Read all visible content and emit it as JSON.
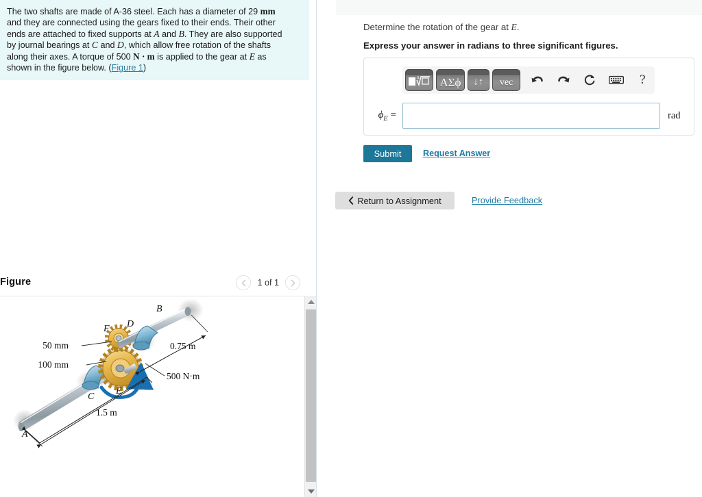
{
  "problem": {
    "line1_a": "The two shafts are made of A-36 steel. Each has a diameter of 29 ",
    "unit_mm": "mm",
    "line2": "and they are connected using the gears fixed to their ends. Their other",
    "line3_a": "ends are attached to fixed supports at ",
    "var_A": "A",
    "line3_b": " and ",
    "var_B": "B",
    "line3_c": ". They are also supported",
    "line4_a": "by journal bearings at ",
    "var_C": "C",
    "line4_b": " and ",
    "var_D": "D",
    "line4_c": ", which allow free rotation of the shafts",
    "line5_a": "along their axes. A torque of 500 ",
    "unit_Nm": "N · m",
    "line5_b": " is applied to the gear at ",
    "var_E": "E",
    "line5_c": " as",
    "line6_a": "shown in the figure below. (",
    "figure_link": "Figure 1",
    "line6_b": ")"
  },
  "figure": {
    "title": "Figure",
    "pager_label": "1 of 1",
    "prev_icon": "chevron-left-icon",
    "next_icon": "chevron-right-icon",
    "labels": {
      "A": "A",
      "B": "B",
      "C": "C",
      "D": "D",
      "E": "E",
      "F": "F",
      "gear_small": "50 mm",
      "gear_large": "100 mm",
      "torque": "500 N·m",
      "len_left": "1.5 m",
      "len_right": "0.75 m"
    }
  },
  "question": {
    "prompt_a": "Determine the rotation of the gear at ",
    "prompt_var": "E",
    "prompt_b": ".",
    "instruction": "Express your answer in radians to three significant figures."
  },
  "answer": {
    "label_phi": "ϕ",
    "label_sub": "E",
    "label_eq": " =",
    "value": "",
    "placeholder": "",
    "unit": "rad"
  },
  "toolbar": {
    "buttons": [
      {
        "name": "template-root-button",
        "glyph": "■√□"
      },
      {
        "name": "greek-symbols-button",
        "glyph": "ΑΣϕ"
      },
      {
        "name": "units-toggle-button",
        "glyph": "↓↑"
      },
      {
        "name": "vector-button",
        "glyph": "vec"
      }
    ],
    "icons": [
      {
        "name": "undo-icon",
        "title": "undo"
      },
      {
        "name": "redo-icon",
        "title": "redo"
      },
      {
        "name": "reset-icon",
        "title": "reset"
      },
      {
        "name": "keyboard-icon",
        "title": "keyboard"
      },
      {
        "name": "help-icon",
        "title": "help",
        "glyph": "?"
      }
    ]
  },
  "actions": {
    "submit_label": "Submit",
    "request_answer_label": "Request Answer",
    "return_label": "Return to Assignment",
    "return_icon": "chevron-left-icon",
    "feedback_label": "Provide Feedback"
  },
  "colors": {
    "accent": "#1c7799",
    "link": "#1d7ba3",
    "problem_bg": "#e8f7f7",
    "input_border": "#93bdd0",
    "gear": "#e8b84b",
    "bearing": "#7fb8d4",
    "shaft": "#b9c3c9"
  }
}
